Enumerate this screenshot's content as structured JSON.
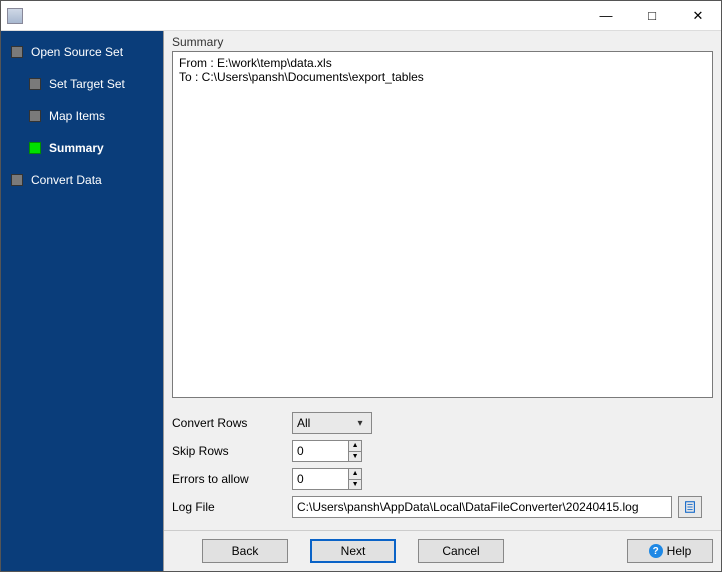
{
  "window": {
    "title": ""
  },
  "sidebar": {
    "steps": [
      {
        "label": "Open Source Set",
        "child": false,
        "active": false
      },
      {
        "label": "Set Target Set",
        "child": true,
        "active": false
      },
      {
        "label": "Map Items",
        "child": true,
        "active": false
      },
      {
        "label": "Summary",
        "child": true,
        "active": true
      },
      {
        "label": "Convert Data",
        "child": false,
        "active": false
      }
    ]
  },
  "main": {
    "section_label": "Summary",
    "summary_text": "From : E:\\work\\temp\\data.xls\nTo : C:\\Users\\pansh\\Documents\\export_tables",
    "convert_rows_label": "Convert Rows",
    "convert_rows_value": "All",
    "skip_rows_label": "Skip Rows",
    "skip_rows_value": "0",
    "errors_label": "Errors to allow",
    "errors_value": "0",
    "log_file_label": "Log File",
    "log_file_value": "C:\\Users\\pansh\\AppData\\Local\\DataFileConverter\\20240415.log"
  },
  "buttons": {
    "back": "Back",
    "next": "Next",
    "cancel": "Cancel",
    "help": "Help"
  }
}
